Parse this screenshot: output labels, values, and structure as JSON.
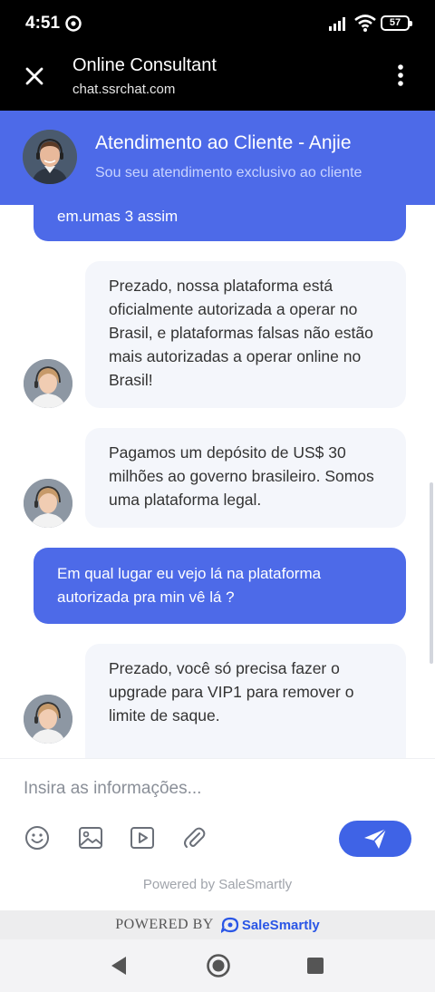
{
  "status_bar": {
    "time": "4:51",
    "battery": "57"
  },
  "header": {
    "title": "Online Consultant",
    "url": "chat.ssrchat.com"
  },
  "agent": {
    "name": "Atendimento ao Cliente - Anjie",
    "status": "Sou seu atendimento exclusivo ao cliente"
  },
  "messages": [
    {
      "from": "user",
      "text": "em.umas 3 assim"
    },
    {
      "from": "agent",
      "text": "Prezado, nossa plataforma está oficialmente autorizada a operar no Brasil, e plataformas falsas não estão mais autorizadas a operar online no Brasil!"
    },
    {
      "from": "agent",
      "text": "Pagamos um depósito de US$ 30 milhões ao governo brasileiro. Somos uma plataforma legal."
    },
    {
      "from": "user",
      "text": "Em qual lugar eu vejo lá na plataforma autorizada pra min vê lá ?"
    },
    {
      "from": "agent",
      "text": "Prezado, você só precisa fazer o upgrade para VIP1 para remover o limite de saque."
    }
  ],
  "composer": {
    "placeholder": "Insira as informações...",
    "powered_text": "Powered by SaleSmartly"
  },
  "footer": {
    "powered_label": "POWERED BY",
    "brand": "SaleSmartly"
  },
  "colors": {
    "accent": "#4d6ae8",
    "agent_bubble": "#f4f6fb",
    "send_button": "#3f63e6"
  },
  "icons": [
    "close-icon",
    "more-vert-icon",
    "emoji-icon",
    "image-icon",
    "video-icon",
    "attachment-icon",
    "send-icon",
    "back-icon",
    "home-icon",
    "recents-icon"
  ]
}
